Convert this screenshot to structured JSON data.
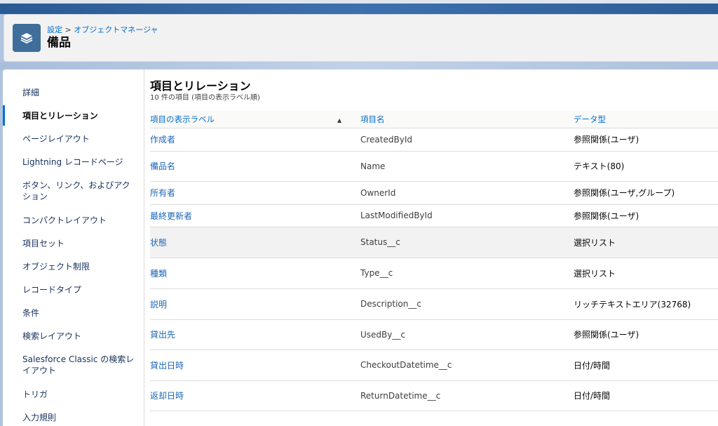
{
  "header": {
    "breadcrumb": [
      "設定",
      "オブジェクトマネージャ"
    ],
    "breadcrumb_sep": ">",
    "title": "備品",
    "icon": "layers-icon"
  },
  "sidebar": {
    "items": [
      {
        "label": "詳細",
        "active": false
      },
      {
        "label": "項目とリレーション",
        "active": true
      },
      {
        "label": "ページレイアウト",
        "active": false
      },
      {
        "label": "Lightning レコードページ",
        "active": false
      },
      {
        "label": "ボタン、リンク、およびアクション",
        "active": false
      },
      {
        "label": "コンパクトレイアウト",
        "active": false
      },
      {
        "label": "項目セット",
        "active": false
      },
      {
        "label": "オブジェクト制限",
        "active": false
      },
      {
        "label": "レコードタイプ",
        "active": false
      },
      {
        "label": "条件",
        "active": false
      },
      {
        "label": "検索レイアウト",
        "active": false
      },
      {
        "label": "Salesforce Classic の検索レイアウト",
        "active": false
      },
      {
        "label": "トリガ",
        "active": false
      },
      {
        "label": "入力規則",
        "active": false
      }
    ]
  },
  "main": {
    "title": "項目とリレーション",
    "subtitle": "10 件の項目 (項目の表示ラベル順)",
    "columns": [
      "項目の表示ラベル",
      "項目名",
      "データ型"
    ],
    "sort_indicator": "▲",
    "rows": [
      {
        "label": "作成者",
        "name": "CreatedById",
        "type": "参照関係(ユーザ)"
      },
      {
        "label": "備品名",
        "name": "Name",
        "type": "テキスト(80)"
      },
      {
        "label": "所有者",
        "name": "OwnerId",
        "type": "参照関係(ユーザ,グループ)"
      },
      {
        "label": "最終更新者",
        "name": "LastModifiedById",
        "type": "参照関係(ユーザ)"
      },
      {
        "label": "状態",
        "name": "Status__c",
        "type": "選択リスト"
      },
      {
        "label": "種類",
        "name": "Type__c",
        "type": "選択リスト"
      },
      {
        "label": "説明",
        "name": "Description__c",
        "type": "リッチテキストエリア(32768)"
      },
      {
        "label": "貸出先",
        "name": "UsedBy__c",
        "type": "参照関係(ユーザ)"
      },
      {
        "label": "貸出日時",
        "name": "CheckoutDatetime__c",
        "type": "日付/時間"
      },
      {
        "label": "返却日時",
        "name": "ReturnDatetime__c",
        "type": "日付/時間"
      }
    ]
  },
  "colors": {
    "link": "#1b65b5",
    "brand_band": "#3d71ad",
    "active_indicator": "#0070d2",
    "header_icon_bg": "#3f6e9a"
  }
}
